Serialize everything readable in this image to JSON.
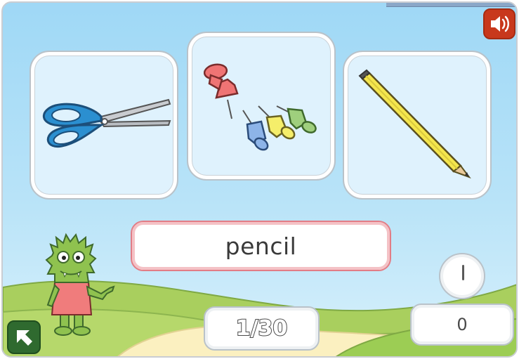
{
  "game": {
    "target_word": "pencil",
    "progress": "1/30",
    "score": "0",
    "timer_fraction": 0
  },
  "cards": [
    {
      "item": "scissors"
    },
    {
      "item": "push pins"
    },
    {
      "item": "pencil"
    }
  ],
  "controls": {
    "sound_icon": "speaker-icon",
    "back_icon": "arrow-up-left-icon"
  },
  "colors": {
    "sky": "#a8dcf7",
    "hill": "#a9cf5e",
    "path": "#fbf0c0",
    "sound_button": "#c8381c",
    "back_button": "#2f6a2f",
    "word_border": "#e27d86"
  }
}
